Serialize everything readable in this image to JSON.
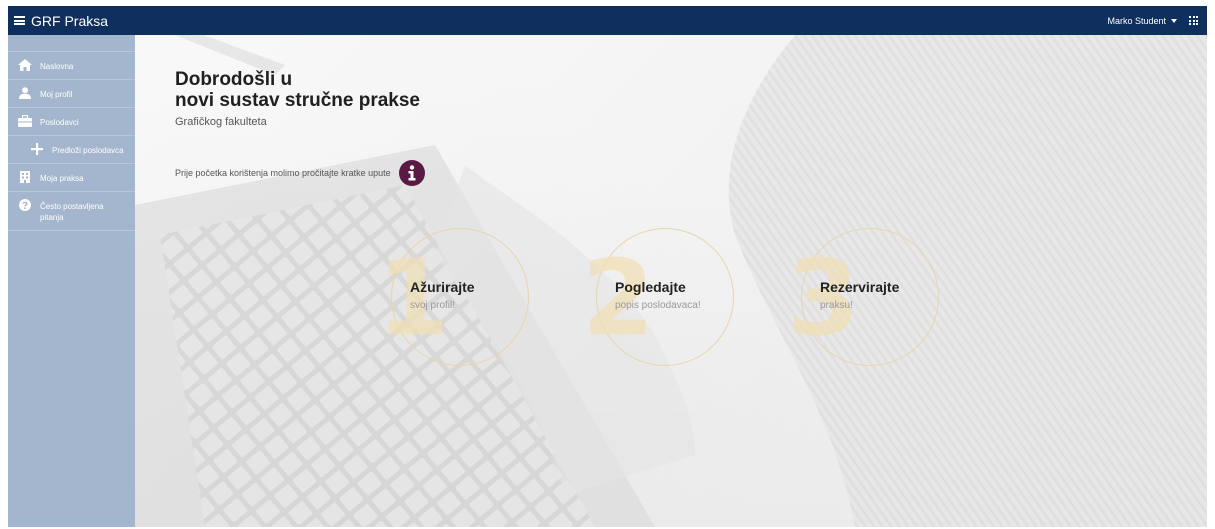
{
  "topbar": {
    "brand": "GRF Praksa",
    "menu_icon": "hamburger-icon",
    "user_name": "Marko Student",
    "apps_icon": "apps-grid-icon",
    "background": "#0f2f5e"
  },
  "sidebar": {
    "background": "#a3b6cd",
    "items": [
      {
        "label": "Naslovna",
        "icon": "home-icon"
      },
      {
        "label": "Moj profil",
        "icon": "user-icon"
      },
      {
        "label": "Poslodavci",
        "icon": "briefcase-icon"
      },
      {
        "label": "Predloži poslodavca",
        "icon": "plus-icon"
      },
      {
        "label": "Moja praksa",
        "icon": "building-icon"
      },
      {
        "label": "Često postavljena pitanja",
        "icon": "question-circle-icon"
      }
    ]
  },
  "main": {
    "title_line1": "Dobrodošli u",
    "title_line2": "novi sustav stručne prakse",
    "subtitle": "Grafičkog fakulteta",
    "notice": "Prije početka korištenja molimo pročitajte kratke upute",
    "info_icon": "info-icon",
    "info_color": "#5b1a44",
    "steps": [
      {
        "number": "1",
        "title": "Ažurirajte",
        "desc": "svoj profil!"
      },
      {
        "number": "2",
        "title": "Pogledajte",
        "desc": "popis poslodavaca!"
      },
      {
        "number": "3",
        "title": "Rezervirajte",
        "desc": "praksu!"
      }
    ]
  }
}
